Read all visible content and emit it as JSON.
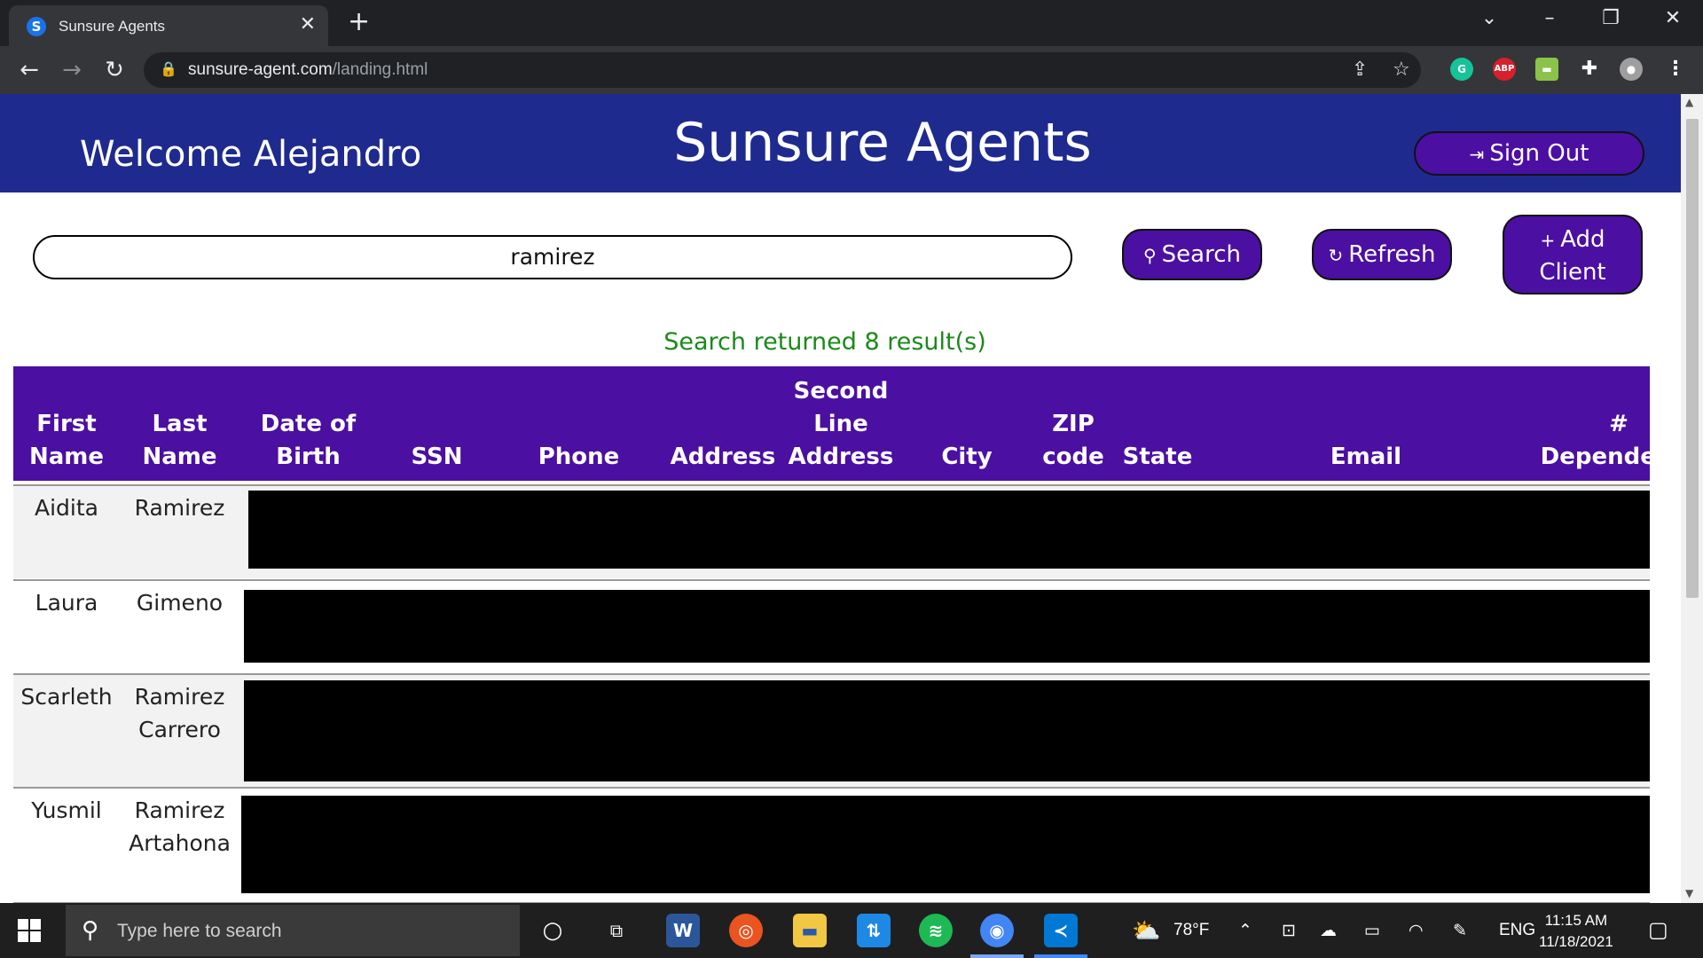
{
  "browser": {
    "tab_title": "Sunsure Agents",
    "url_host": "sunsure-agent.com",
    "url_path": "/landing.html"
  },
  "page": {
    "welcome": "Welcome Alejandro",
    "title": "Sunsure Agents",
    "signout_label": "Sign Out",
    "search_value": "ramirez",
    "search_label": "Search",
    "refresh_label": "Refresh",
    "add_label_1": "Add",
    "add_label_2": "Client",
    "result_message": "Search returned 8 result(s)"
  },
  "table": {
    "headers": [
      [
        "First",
        "Name"
      ],
      [
        "Last",
        "Name"
      ],
      [
        "Date of",
        "Birth"
      ],
      [
        "SSN"
      ],
      [
        "Phone"
      ],
      [
        "Address"
      ],
      [
        "Second",
        "Line",
        "Address"
      ],
      [
        "City"
      ],
      [
        "ZIP",
        "code"
      ],
      [
        "State"
      ],
      [
        "Email"
      ],
      [
        "#",
        "Dependents"
      ]
    ],
    "rows": [
      {
        "first": [
          "Aidita"
        ],
        "last": [
          "Ramirez"
        ]
      },
      {
        "first": [
          "Laura"
        ],
        "last": [
          "Gimeno"
        ]
      },
      {
        "first": [
          "Scarleth"
        ],
        "last": [
          "Ramirez",
          "Carrero"
        ]
      },
      {
        "first": [
          "Yusmil"
        ],
        "last": [
          "Ramirez",
          "Artahona"
        ]
      }
    ]
  },
  "taskbar": {
    "search_placeholder": "Type here to search",
    "weather": "78°F",
    "language": "ENG",
    "time": "11:15 AM",
    "date": "11/18/2021"
  },
  "colors": {
    "header_bg": "#1f2a8f",
    "button_bg": "#4b0fa2",
    "result_text": "#1a8a1a"
  }
}
